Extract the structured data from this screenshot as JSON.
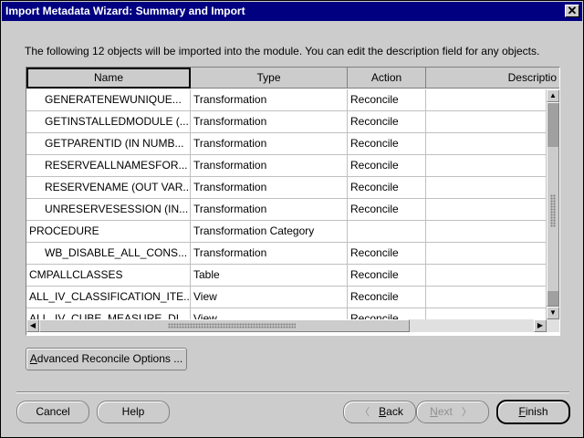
{
  "window": {
    "title": "Import Metadata Wizard: Summary and Import",
    "close_glyph": "✕"
  },
  "description": "The following 12 objects will be imported into the module. You can edit the description field for any objects.",
  "table": {
    "columns": [
      "Name",
      "Type",
      "Action",
      "Description"
    ],
    "column_header_display": [
      "Name",
      "Type",
      "Action",
      "Descriptio"
    ],
    "rows": [
      {
        "name": "GENERATENEWUNIQUE...",
        "type": "Transformation",
        "action": "Reconcile",
        "description": "",
        "indent": true
      },
      {
        "name": "GETINSTALLEDMODULE (...",
        "type": "Transformation",
        "action": "Reconcile",
        "description": "",
        "indent": true
      },
      {
        "name": "GETPARENTID (IN NUMB...",
        "type": "Transformation",
        "action": "Reconcile",
        "description": "",
        "indent": true
      },
      {
        "name": "RESERVEALLNAMESFOR...",
        "type": "Transformation",
        "action": "Reconcile",
        "description": "",
        "indent": true
      },
      {
        "name": "RESERVENAME (OUT VAR...",
        "type": "Transformation",
        "action": "Reconcile",
        "description": "",
        "indent": true
      },
      {
        "name": "UNRESERVESESSION (IN...",
        "type": "Transformation",
        "action": "Reconcile",
        "description": "",
        "indent": true
      },
      {
        "name": "PROCEDURE",
        "type": "Transformation Category",
        "action": "",
        "description": "",
        "indent": false
      },
      {
        "name": "WB_DISABLE_ALL_CONS...",
        "type": "Transformation",
        "action": "Reconcile",
        "description": "",
        "indent": true
      },
      {
        "name": "CMPALLCLASSES",
        "type": "Table",
        "action": "Reconcile",
        "description": "",
        "indent": false
      },
      {
        "name": "ALL_IV_CLASSIFICATION_ITE...",
        "type": "View",
        "action": "Reconcile",
        "description": "",
        "indent": false
      },
      {
        "name": "ALL_IV_CUBE_MEASURE_DI...",
        "type": "View",
        "action": "Reconcile",
        "description": "",
        "indent": false
      }
    ]
  },
  "scrollbars": {
    "up_glyph": "▲",
    "down_glyph": "▼",
    "left_glyph": "◀",
    "right_glyph": "▶"
  },
  "buttons": {
    "advanced": {
      "mnemonic": "A",
      "rest": "dvanced Reconcile Options ..."
    },
    "cancel": "Cancel",
    "help": "Help",
    "back": {
      "mnemonic": "B",
      "rest": "ack",
      "arrow": "〈"
    },
    "next": {
      "mnemonic": "N",
      "rest": "ext",
      "arrow": "〉"
    },
    "finish": {
      "mnemonic": "F",
      "rest": "inish"
    }
  }
}
